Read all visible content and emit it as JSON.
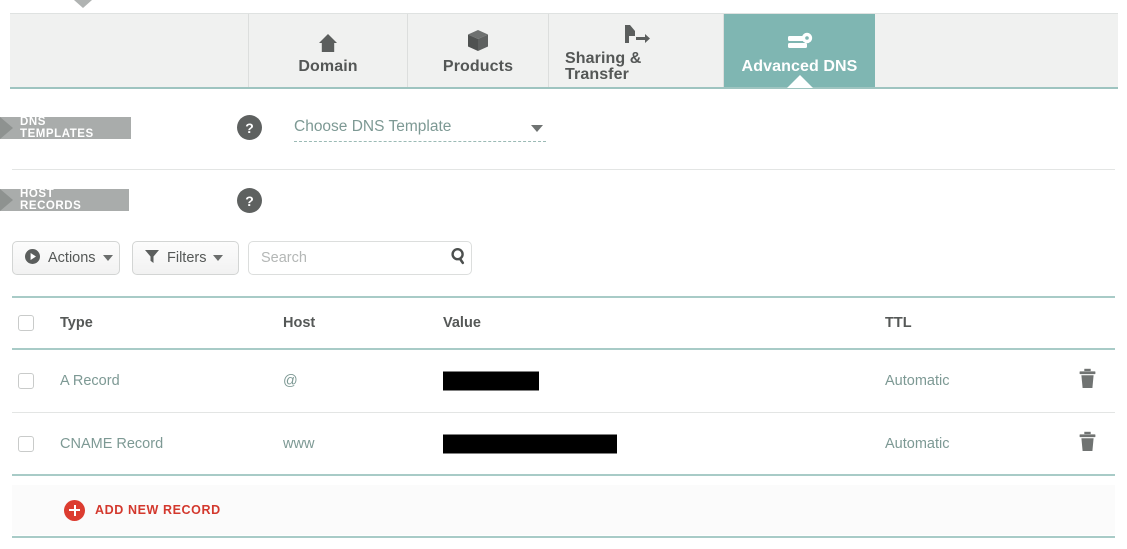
{
  "tabs": [
    {
      "id": "domain",
      "label": "Domain",
      "icon": "home-icon",
      "active": false
    },
    {
      "id": "products",
      "label": "Products",
      "icon": "box-icon",
      "active": false
    },
    {
      "id": "sharing",
      "label": "Sharing & Transfer",
      "icon": "transfer-icon",
      "active": false
    },
    {
      "id": "dns",
      "label": "Advanced DNS",
      "icon": "server-icon",
      "active": true
    }
  ],
  "sections": {
    "dns_templates": {
      "banner_label": "DNS TEMPLATES",
      "help_label": "?",
      "select_value": "Choose DNS Template"
    },
    "host_records": {
      "banner_label": "HOST RECORDS",
      "help_label": "?"
    }
  },
  "toolbar": {
    "actions_label": "Actions",
    "filters_label": "Filters",
    "search_placeholder": "Search",
    "search_value": ""
  },
  "table": {
    "columns": [
      "Type",
      "Host",
      "Value",
      "TTL"
    ],
    "rows": [
      {
        "type": "A Record",
        "host": "@",
        "value": "[redacted]",
        "value_redacted": true,
        "value_bar_width": 96,
        "ttl": "Automatic"
      },
      {
        "type": "CNAME Record",
        "host": "www",
        "value": "[redacted]",
        "value_redacted": true,
        "value_bar_width": 174,
        "ttl": "Automatic"
      }
    ]
  },
  "add_record": {
    "label": "ADD NEW RECORD"
  },
  "colors": {
    "accent_teal": "#7fb6b2",
    "rule_teal": "#a8cbc7",
    "link_teal": "#7d9994",
    "banner_gray": "#a9acab",
    "help_gray": "#5e6160",
    "add_red": "#d3382d",
    "tab_bg": "#f0f1f0"
  }
}
